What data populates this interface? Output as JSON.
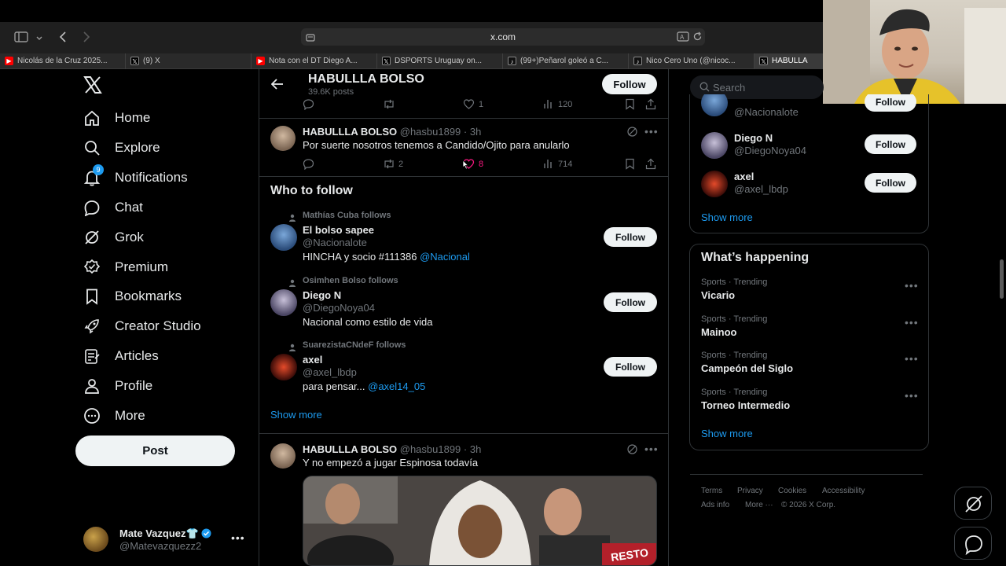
{
  "browser": {
    "url": "x.com",
    "tabs": [
      {
        "label": "Nicolás de la Cruz 2025...",
        "fav": "yt"
      },
      {
        "label": "(9) X",
        "fav": "x"
      },
      {
        "label": "Nota con el DT Diego A...",
        "fav": "yt"
      },
      {
        "label": "DSPORTS Uruguay on...",
        "fav": "x"
      },
      {
        "label": "(99+)Peñarol goleó a C...",
        "fav": "tt"
      },
      {
        "label": "Nico Cero Uno (@nicoc...",
        "fav": "tt"
      },
      {
        "label": "HABULLA",
        "fav": "x"
      }
    ]
  },
  "nav": {
    "items": [
      {
        "label": "Home",
        "icon": "home-icon"
      },
      {
        "label": "Explore",
        "icon": "search-icon"
      },
      {
        "label": "Notifications",
        "icon": "bell-icon",
        "badge": "9"
      },
      {
        "label": "Chat",
        "icon": "chat-icon"
      },
      {
        "label": "Grok",
        "icon": "grok-icon"
      },
      {
        "label": "Premium",
        "icon": "premium-icon"
      },
      {
        "label": "Bookmarks",
        "icon": "bookmark-icon"
      },
      {
        "label": "Creator Studio",
        "icon": "rocket-icon"
      },
      {
        "label": "Articles",
        "icon": "articles-icon"
      },
      {
        "label": "Profile",
        "icon": "profile-icon"
      },
      {
        "label": "More",
        "icon": "more-circle-icon"
      }
    ],
    "post_label": "Post",
    "account": {
      "name": "Mate Vazquez👕",
      "handle": "@Matevazquezz2"
    }
  },
  "header": {
    "title": "HABULLLA BOLSO",
    "subtitle": "39.6K posts",
    "follow_label": "Follow"
  },
  "top_actions": {
    "retweets": "",
    "likes": "1",
    "views": "120"
  },
  "tweet1": {
    "name": "HABULLLA BOLSO",
    "meta": "@hasbu1899 · 3h",
    "text": "Por suerte nosotros tenemos a Candido/Ojito para anularlo",
    "retweets": "2",
    "likes": "8",
    "views": "714"
  },
  "who_to_follow": {
    "title": "Who to follow",
    "show_more": "Show more",
    "users": [
      {
        "context": "Mathías Cuba follows",
        "name": "El bolso sapee",
        "handle": "@Nacionalote",
        "bio": "HINCHA y socio #111386 ",
        "bio_link": "@Nacional",
        "follow": "Follow"
      },
      {
        "context": "Osimhen Bolso follows",
        "name": "Diego N",
        "handle": "@DiegoNoya04",
        "bio": "Nacional como estilo de vida",
        "bio_link": "",
        "follow": "Follow"
      },
      {
        "context": "SuarezistaCNdeF follows",
        "name": "axel",
        "handle": "@axel_lbdp",
        "bio": "para pensar... ",
        "bio_link": "@axel14_05",
        "follow": "Follow"
      }
    ]
  },
  "tweet2": {
    "name": "HABULLLA BOLSO",
    "meta": "@hasbu1899 · 3h",
    "text": "Y no empezó a jugar Espinosa todavía",
    "media_sign": "RESTO"
  },
  "right": {
    "search_placeholder": "Search",
    "might_like": [
      {
        "name": "",
        "handle": "@Nacionalote",
        "follow": "Follow"
      },
      {
        "name": "Diego N",
        "handle": "@DiegoNoya04",
        "follow": "Follow"
      },
      {
        "name": "axel",
        "handle": "@axel_lbdp",
        "follow": "Follow"
      }
    ],
    "show_more": "Show more",
    "happening": {
      "title": "What’s happening",
      "items": [
        {
          "category": "Sports · Trending",
          "topic": "Vicario"
        },
        {
          "category": "Sports · Trending",
          "topic": "Mainoo"
        },
        {
          "category": "Sports · Trending",
          "topic": "Campeón del Siglo"
        },
        {
          "category": "Sports · Trending",
          "topic": "Torneo Intermedio"
        }
      ],
      "show_more": "Show more"
    },
    "footer": [
      "Terms",
      "Privacy",
      "Cookies",
      "Accessibility",
      "Ads info",
      "More ···",
      "© 2026 X Corp."
    ]
  }
}
